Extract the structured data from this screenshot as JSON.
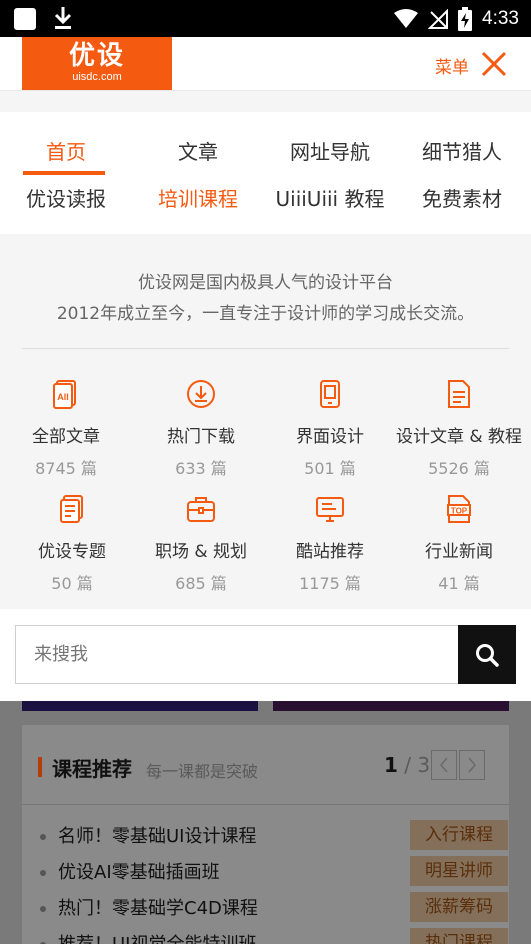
{
  "status_bar": {
    "time": "4:33"
  },
  "header": {
    "logo_main": "优设",
    "logo_sub": "uisdc.com",
    "menu_label": "菜单"
  },
  "nav": {
    "items": [
      {
        "label": "首页",
        "active": true
      },
      {
        "label": "文章",
        "active": false
      },
      {
        "label": "网址导航",
        "active": false
      },
      {
        "label": "细节猎人",
        "active": false
      },
      {
        "label": "优设读报",
        "active": false
      },
      {
        "label": "培训课程",
        "active": true
      },
      {
        "label": "UiiiUiii 教程",
        "active": false
      },
      {
        "label": "免费素材",
        "active": false
      }
    ]
  },
  "intro": {
    "line1": "优设网是国内极具人气的设计平台",
    "line2": "2012年成立至今，一直专注于设计师的学习成长交流。"
  },
  "categories": [
    {
      "label": "全部文章",
      "count": "8745 篇",
      "icon": "all-articles-icon"
    },
    {
      "label": "热门下载",
      "count": "633 篇",
      "icon": "download-icon"
    },
    {
      "label": "界面设计",
      "count": "501 篇",
      "icon": "mobile-icon"
    },
    {
      "label": "设计文章 & 教程",
      "count": "5526 篇",
      "icon": "document-icon"
    },
    {
      "label": "优设专题",
      "count": "50 篇",
      "icon": "topic-icon"
    },
    {
      "label": "职场 & 规划",
      "count": "685 篇",
      "icon": "briefcase-icon"
    },
    {
      "label": "酷站推荐",
      "count": "1175 篇",
      "icon": "monitor-icon"
    },
    {
      "label": "行业新闻",
      "count": "41 篇",
      "icon": "top-news-icon"
    }
  ],
  "search": {
    "placeholder": "来搜我"
  },
  "courses": {
    "title": "课程推荐",
    "subtitle": "每一课都是突破",
    "page_current": "1",
    "page_total": "/ 3",
    "items": [
      {
        "text": "名师！零基础UI设计课程",
        "tag": "入行课程"
      },
      {
        "text": "优设AI零基础插画班",
        "tag": "明星讲师"
      },
      {
        "text": "热门！零基础学C4D课程",
        "tag": "涨薪筹码"
      },
      {
        "text": "推荐！UI视觉全能特训班",
        "tag": "热门课程"
      }
    ]
  },
  "colors": {
    "accent": "#f55a11"
  }
}
